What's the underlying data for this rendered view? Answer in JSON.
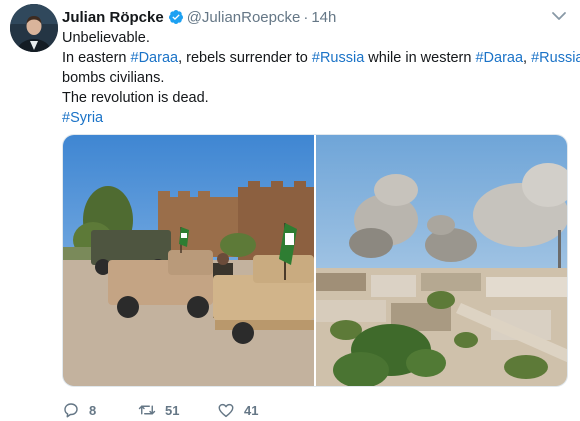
{
  "author": {
    "display_name": "Julian Röpcke",
    "handle": "@JulianRoepcke",
    "separator": "·",
    "timestamp": "14h",
    "verified": true
  },
  "tweet": {
    "line1": "Unbelievable.",
    "line2": {
      "t1": "In eastern ",
      "h1": "#Daraa",
      "t2": ", rebels surrender to ",
      "h2": "#Russia",
      "t3": " while in western ",
      "h3": "#Daraa",
      "t4": ", ",
      "h4": "#Russia"
    },
    "line3": "bombs civilians.",
    "line4": "The revolution is dead.",
    "line5": {
      "h1": "#Syria"
    }
  },
  "actions": {
    "reply_count": "8",
    "retweet_count": "51",
    "like_count": "41"
  },
  "colors": {
    "hashtag": "#1b73c7",
    "verified_badge": "#1da1f2",
    "muted": "#657786"
  },
  "icons": [
    "verified-badge-icon",
    "chevron-down-icon",
    "reply-icon",
    "retweet-icon",
    "like-icon"
  ]
}
